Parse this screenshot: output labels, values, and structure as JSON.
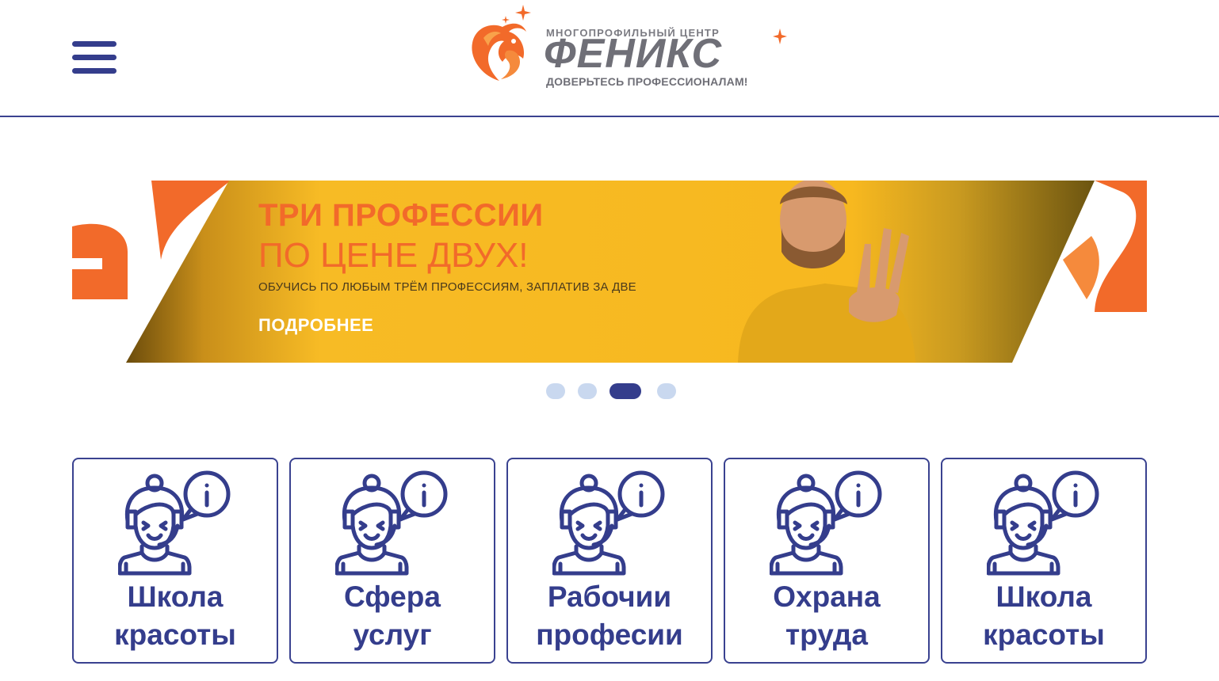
{
  "header": {
    "menu_icon": "hamburger-menu-icon",
    "logo": {
      "subtitle": "МНОГОПРОФИЛЬНЫЙ ЦЕНТР",
      "name": "ФЕНИКС",
      "tagline": "ДОВЕРЬТЕСЬ ПРОФЕССИОНАЛАМ!"
    }
  },
  "banner": {
    "title_line1": "ТРИ ПРОФЕССИИ",
    "title_line2": "ПО ЦЕНЕ ДВУХ!",
    "text": "ОБУЧИСЬ ПО ЛЮБЫМ ТРЁМ ПРОФЕССИЯМ, ЗАПЛАТИВ ЗА ДВЕ",
    "button_label": "ПОДРОБНЕЕ",
    "slides_count": 4,
    "active_slide": 3
  },
  "cards": [
    {
      "line1": "Школа",
      "line2": "красоты",
      "icon": "support-operator-info-icon"
    },
    {
      "line1": "Сфера",
      "line2": "услуг",
      "icon": "support-operator-info-icon"
    },
    {
      "line1": "Рабочии",
      "line2": "професии",
      "icon": "support-operator-info-icon"
    },
    {
      "line1": "Охрана",
      "line2": "труда",
      "icon": "support-operator-info-icon"
    },
    {
      "line1": "Школа",
      "line2": "красоты",
      "icon": "support-operator-info-icon"
    }
  ],
  "colors": {
    "primary": "#343d8c",
    "accent": "#f26a2a",
    "banner_yellow": "#f6b621",
    "dot_inactive": "#c9d8ef"
  }
}
